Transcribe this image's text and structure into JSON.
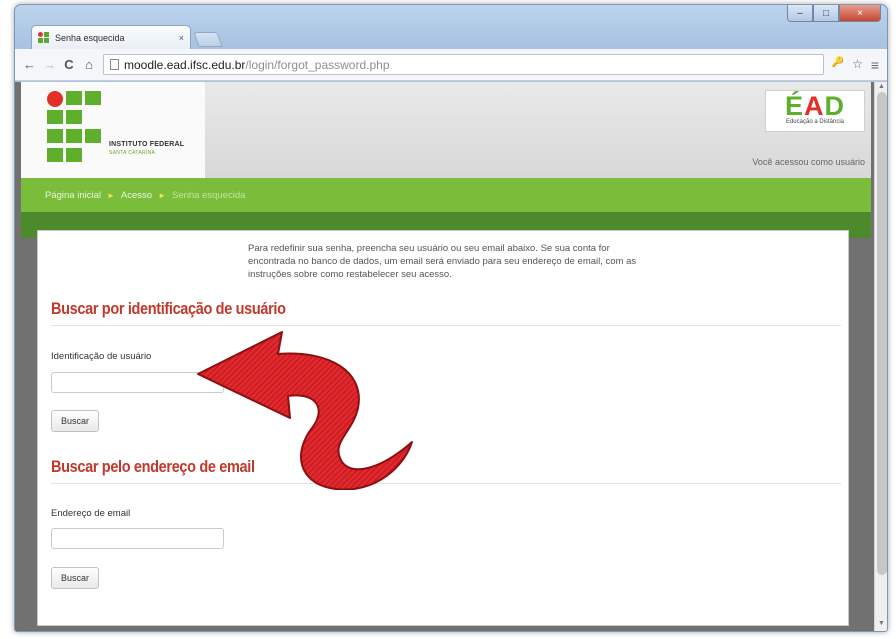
{
  "browser": {
    "tab_title": "Senha esquecida",
    "tab_close": "×",
    "url_host": "moodle.ead.ifsc.edu.br",
    "url_path": "/login/forgot_password.php",
    "back": "←",
    "forward": "→",
    "reload": "C",
    "home": "⌂",
    "key_icon": "🔑",
    "star_icon": "☆",
    "menu_icon": "≡"
  },
  "window_controls": {
    "minimize": "–",
    "maximize": "□",
    "close": "×"
  },
  "header": {
    "institution_name": "INSTITUTO FEDERAL",
    "institution_campus": "SANTA CATARINA",
    "ead_logo": {
      "e": "É",
      "a": "A",
      "d": "D"
    },
    "ead_subtitle": "Educação a Distância",
    "user_status": "Você acessou como usuário"
  },
  "breadcrumb": {
    "home": "Página inicial",
    "access": "Acesso",
    "current": "Senha esquecida",
    "separator": "►"
  },
  "intro_text": "Para redefinir sua senha, preencha seu usuário ou seu email abaixo. Se sua conta for encontrada no banco de dados, um email será enviado para seu endereço de email, com as instruções sobre como restabelecer seu acesso.",
  "section_username": {
    "title": "Buscar por identificação de usuário",
    "field_label": "Identificação de usuário",
    "field_value": "",
    "button_label": "Buscar"
  },
  "section_email": {
    "title": "Buscar pelo endereço de email",
    "field_label": "Endereço de email",
    "field_value": "",
    "button_label": "Buscar"
  },
  "colors": {
    "accent_green": "#79bd3a",
    "dark_green": "#4d8a2c",
    "title_red": "#c0392b",
    "arrow_red": "#d8262a"
  }
}
